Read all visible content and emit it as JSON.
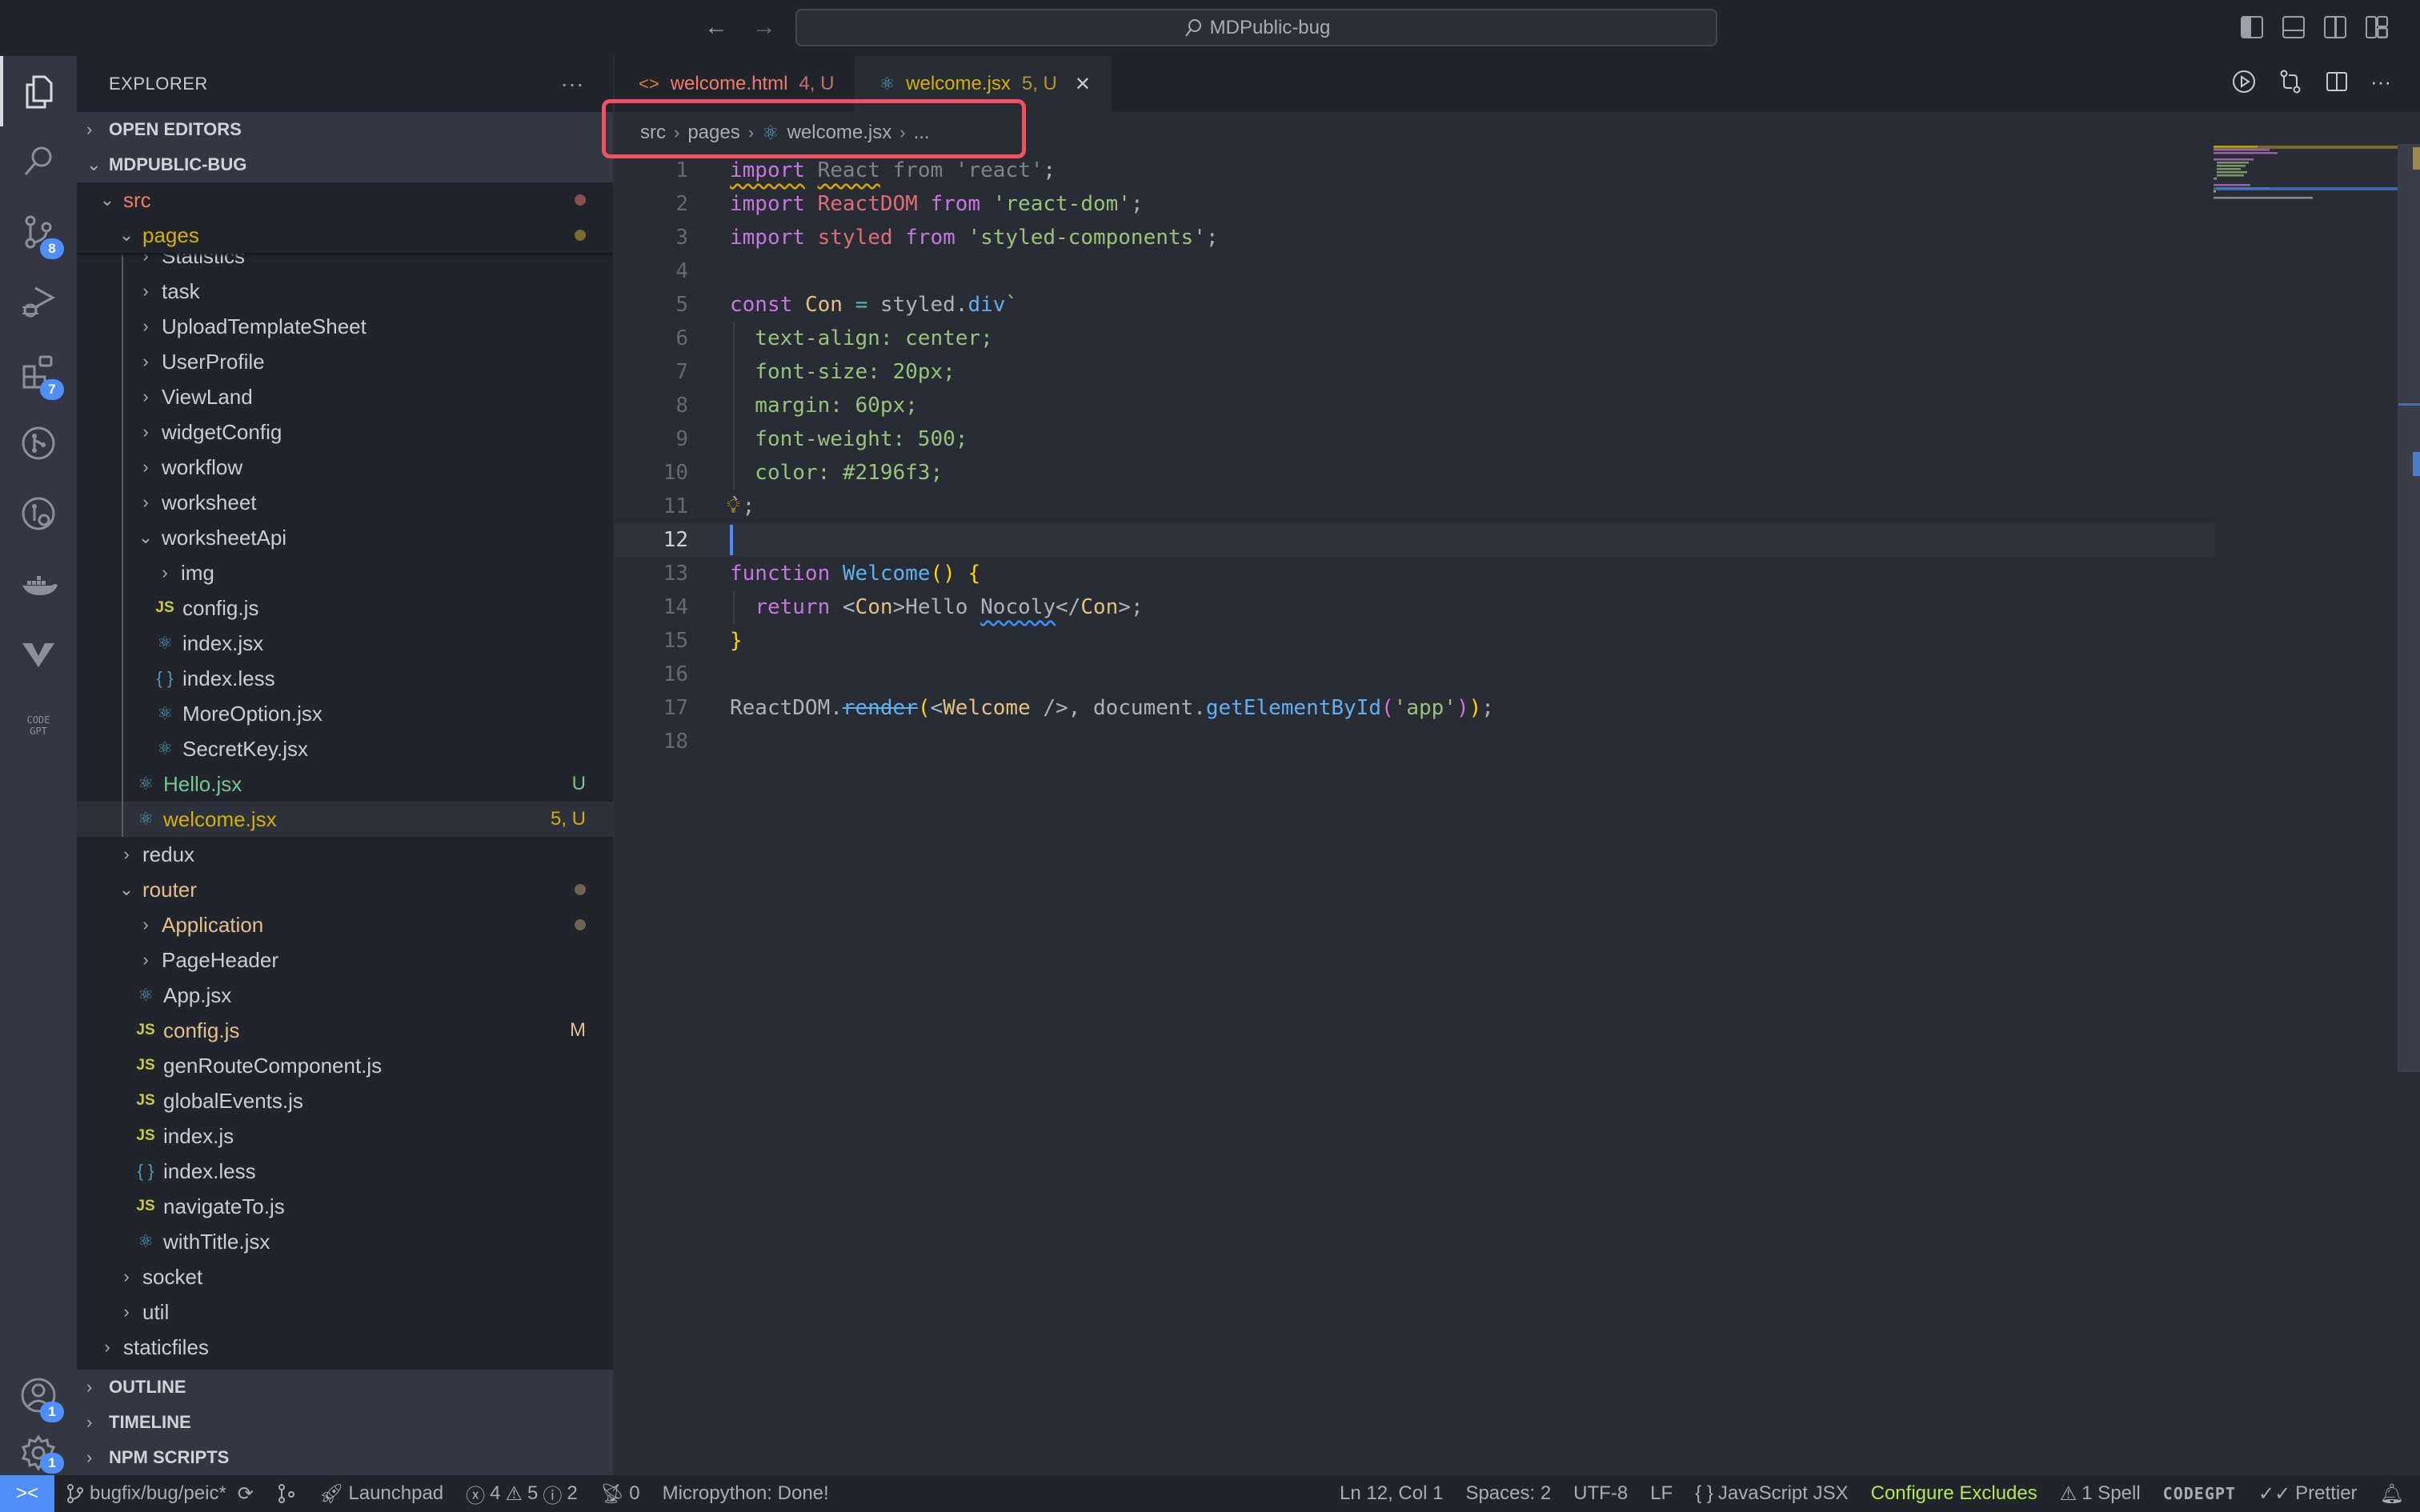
{
  "titlebar": {
    "search_text": "MDPublic-bug",
    "back": "←",
    "forward": "→"
  },
  "activity_bar": {
    "items": [
      {
        "name": "explorer",
        "badge": null
      },
      {
        "name": "search",
        "badge": null
      },
      {
        "name": "source-control",
        "badge": "8"
      },
      {
        "name": "run-and-debug",
        "badge": null
      },
      {
        "name": "extensions",
        "badge": "7"
      },
      {
        "name": "gitlens",
        "badge": null
      },
      {
        "name": "gitlens-inspect",
        "badge": null
      },
      {
        "name": "docker",
        "badge": null
      },
      {
        "name": "vitest",
        "badge": null
      },
      {
        "name": "codegpt",
        "badge": null
      }
    ],
    "accounts_badge": "1",
    "settings_badge": "1",
    "codegpt_label": "CODE GPT"
  },
  "sidebar": {
    "title": "EXPLORER",
    "more": "···",
    "open_editors": "OPEN EDITORS",
    "workspace": "MDPUBLIC-BUG",
    "tree": [
      {
        "label": "src",
        "type": "folder",
        "open": true,
        "color": "#f07b6b",
        "dot": "#8a4e4e"
      },
      {
        "label": "pages",
        "type": "folder",
        "open": true,
        "color": "#d4b106",
        "dot": "#7a6b2e"
      },
      {
        "label": "Statistics",
        "type": "folder",
        "open": false,
        "partial": true
      },
      {
        "label": "task",
        "type": "folder",
        "open": false
      },
      {
        "label": "UploadTemplateSheet",
        "type": "folder",
        "open": false
      },
      {
        "label": "UserProfile",
        "type": "folder",
        "open": false
      },
      {
        "label": "ViewLand",
        "type": "folder",
        "open": false
      },
      {
        "label": "widgetConfig",
        "type": "folder",
        "open": false
      },
      {
        "label": "workflow",
        "type": "folder",
        "open": false
      },
      {
        "label": "worksheet",
        "type": "folder",
        "open": false
      },
      {
        "label": "worksheetApi",
        "type": "folder",
        "open": true
      },
      {
        "label": "img",
        "type": "folder",
        "open": false
      },
      {
        "label": "config.js",
        "type": "js"
      },
      {
        "label": "index.jsx",
        "type": "jsx"
      },
      {
        "label": "index.less",
        "type": "less"
      },
      {
        "label": "MoreOption.jsx",
        "type": "jsx"
      },
      {
        "label": "SecretKey.jsx",
        "type": "jsx"
      },
      {
        "label": "Hello.jsx",
        "type": "jsx",
        "color": "#73c991",
        "decoration": "U"
      },
      {
        "label": "welcome.jsx",
        "type": "jsx",
        "color": "#d4b106",
        "decoration": "5, U",
        "selected": true
      },
      {
        "label": "redux",
        "type": "folder",
        "open": false
      },
      {
        "label": "router",
        "type": "folder",
        "open": true,
        "color": "#e2c08d",
        "dot": "#6e6450"
      },
      {
        "label": "Application",
        "type": "folder",
        "open": false,
        "color": "#e2c08d",
        "dot": "#6e6450"
      },
      {
        "label": "PageHeader",
        "type": "folder",
        "open": false
      },
      {
        "label": "App.jsx",
        "type": "jsx"
      },
      {
        "label": "config.js",
        "type": "js",
        "color": "#e2c08d",
        "decoration": "M"
      },
      {
        "label": "genRouteComponent.js",
        "type": "js"
      },
      {
        "label": "globalEvents.js",
        "type": "js"
      },
      {
        "label": "index.js",
        "type": "js"
      },
      {
        "label": "index.less",
        "type": "less"
      },
      {
        "label": "navigateTo.js",
        "type": "js"
      },
      {
        "label": "withTitle.jsx",
        "type": "jsx"
      },
      {
        "label": "socket",
        "type": "folder",
        "open": false
      },
      {
        "label": "util",
        "type": "folder",
        "open": false
      },
      {
        "label": "staticfiles",
        "type": "folder",
        "open": false
      }
    ],
    "outline": "OUTLINE",
    "timeline": "TIMELINE",
    "npm_scripts": "NPM SCRIPTS"
  },
  "tabs": [
    {
      "label": "welcome.html",
      "decoration": "4, U",
      "icon": "<>",
      "color": "#f07b6b",
      "dec_color": "#c7716a",
      "active": false
    },
    {
      "label": "welcome.jsx",
      "decoration": "5, U",
      "icon": "⚛",
      "color": "#d4b106",
      "dec_color": "#b8972a",
      "active": true,
      "close": "✕"
    }
  ],
  "breadcrumb": {
    "items": [
      "src",
      "pages",
      "welcome.jsx",
      "..."
    ],
    "sep": "›"
  },
  "editor": {
    "current_line": 12,
    "line_numbers": [
      "1",
      "2",
      "3",
      "4",
      "5",
      "6",
      "7",
      "8",
      "9",
      "10",
      "11",
      "12",
      "13",
      "14",
      "15",
      "16",
      "17",
      "18"
    ],
    "code": {
      "l1": [
        "import",
        " ",
        "React",
        " ",
        "from",
        " ",
        "'react'",
        ";"
      ],
      "l2": [
        "import",
        " ",
        "ReactDOM",
        " ",
        "from",
        " ",
        "'react-dom'",
        ";"
      ],
      "l3": [
        "import",
        " ",
        "styled",
        " ",
        "from",
        " ",
        "'styled-components'",
        ";"
      ],
      "l5": [
        "const",
        " ",
        "Con",
        " ",
        "=",
        " ",
        "styled",
        ".",
        "div",
        "`"
      ],
      "l6": "  text-align: center;",
      "l7": "  font-size: 20px;",
      "l8": "  margin: 60px;",
      "l9": "  font-weight: 500;",
      "l10": "  color: #2196f3;",
      "l11": "`;",
      "l13": [
        "function",
        " ",
        "Welcome",
        "()",
        " ",
        "{"
      ],
      "l14": [
        "  ",
        "return",
        " <",
        "Con",
        ">Hello ",
        "Nocoly",
        "</",
        "Con",
        ">;"
      ],
      "l15": "}",
      "l17": [
        "ReactDOM",
        ".",
        "render",
        "(",
        "<",
        "Welcome",
        " />, document.",
        "getElementById",
        "(",
        "'app'",
        ")",
        ")",
        ";"
      ]
    }
  },
  "statusbar": {
    "remote": "><",
    "branch": "bugfix/bug/peic*",
    "launchpad": "Launchpad",
    "errors": "4",
    "warnings": "5",
    "infos": "2",
    "ports": "0",
    "micropython": "Micropython: Done!",
    "position": "Ln 12, Col 1",
    "spaces": "Spaces: 2",
    "encoding": "UTF-8",
    "eol": "LF",
    "language": "JavaScript JSX",
    "configure": "Configure Excludes",
    "spell": "1 Spell",
    "codegpt": "CODEGPT",
    "prettier": "Prettier"
  }
}
